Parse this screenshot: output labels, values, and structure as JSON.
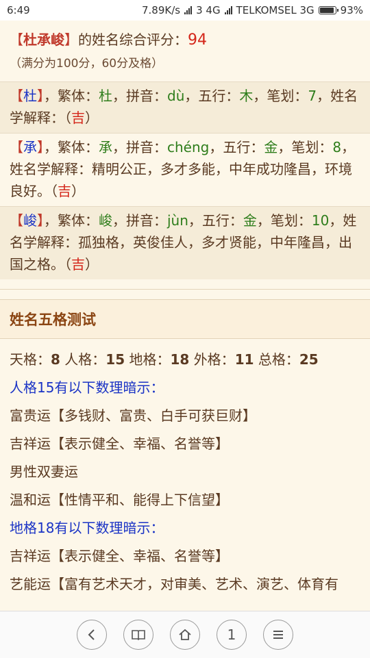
{
  "status_bar": {
    "time": "6:49",
    "speed": "7.89K/s",
    "sim": "3 4G",
    "carrier": "TELKOMSEL 3G",
    "battery": "93%"
  },
  "summary": {
    "name": "杜承峻",
    "prefix": "的姓名综合评分：",
    "score": "94",
    "note": "（满分为100分，60分及格）"
  },
  "chars": [
    {
      "char": "杜",
      "fanti": "杜",
      "pinyin": "dù",
      "wuxing": "木",
      "bihua": "7",
      "explain": "",
      "ji": "吉"
    },
    {
      "char": "承",
      "fanti": "承",
      "pinyin": "chéng",
      "wuxing": "金",
      "bihua": "8",
      "explain": "精明公正，多才多能，中年成功隆昌，环境良好。",
      "ji": "吉"
    },
    {
      "char": "峻",
      "fanti": "峻",
      "pinyin": "jùn",
      "wuxing": "金",
      "bihua": "10",
      "explain": "孤独格，英俊佳人，多才贤能，中年隆昌，出国之格。",
      "ji": "吉"
    }
  ],
  "labels": {
    "fanti": "繁体：",
    "pinyin": "拼音：",
    "wuxing": "五行：",
    "bihua": "笔划：",
    "explain": "姓名学解释："
  },
  "section_title": "姓名五格测试",
  "wuge": {
    "tian_label": "天格：",
    "tian": "8",
    "ren_label": "人格：",
    "ren": "15",
    "di_label": "地格：",
    "di": "18",
    "wai_label": "外格：",
    "wai": "11",
    "zong_label": "总格：",
    "zong": "25"
  },
  "renge_header": "人格15有以下数理暗示：",
  "renge_items": [
    "富贵运【多钱财、富贵、白手可获巨财】",
    "吉祥运【表示健全、幸福、名誉等】",
    "男性双妻运",
    "温和运【性情平和、能得上下信望】"
  ],
  "dige_header": "地格18有以下数理暗示：",
  "dige_items": [
    "吉祥运【表示健全、幸福、名誉等】",
    "艺能运【富有艺术天才，对审美、艺术、演艺、体育有"
  ],
  "nav": {
    "back": "‹",
    "book": "book",
    "home": "home",
    "tabs": "1",
    "menu": "≡"
  }
}
